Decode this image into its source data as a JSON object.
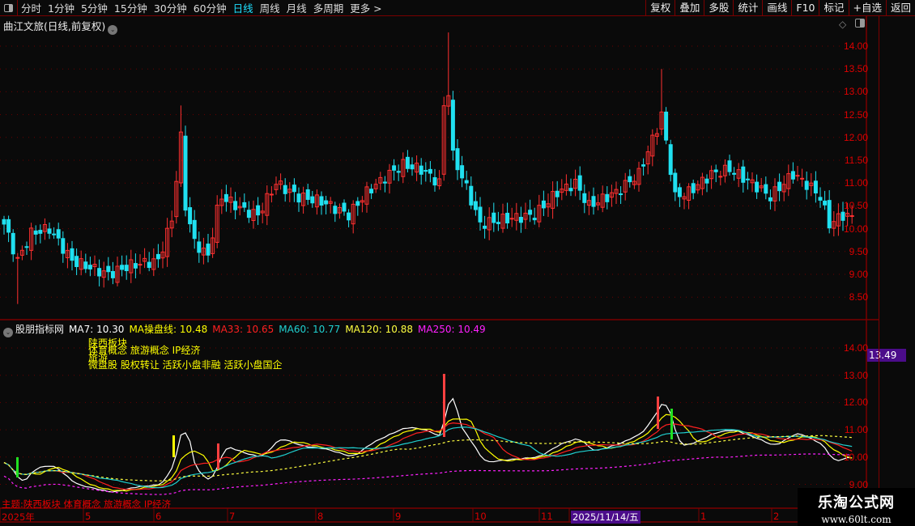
{
  "toolbar": {
    "periods": [
      "分时",
      "1分钟",
      "5分钟",
      "15分钟",
      "30分钟",
      "60分钟",
      "日线",
      "周线",
      "月线",
      "多周期",
      "更多 >"
    ],
    "active": "日线",
    "right_buttons": [
      "复权",
      "叠加",
      "多股",
      "统计",
      "画线",
      "F10",
      "标记",
      "+自选",
      "返回"
    ]
  },
  "main": {
    "title": "曲江文旅(日线,前复权)",
    "price_axis": [
      "14.00",
      "13.50",
      "13.00",
      "12.50",
      "12.00",
      "11.50",
      "11.00",
      "10.50",
      "10.00",
      "9.50",
      "9.00",
      "8.50"
    ]
  },
  "indicator": {
    "name": "股朋指标网",
    "ma": [
      {
        "label": "MA7: 10.30",
        "color": "#ffffff"
      },
      {
        "label": "MA操盘线: 10.48",
        "color": "#ffff00"
      },
      {
        "label": "MA33: 10.65",
        "color": "#ff2020"
      },
      {
        "label": "MA60: 10.77",
        "color": "#20d0d0"
      },
      {
        "label": "MA120: 10.88",
        "color": "#ffff40"
      },
      {
        "label": "MA250: 10.49",
        "color": "#ff20ff"
      }
    ],
    "concepts": [
      "陕西板块",
      "体育概念 旅游概念 IP经济",
      "旅游",
      "微盘股 股权转让 活跃小盘非融 活跃小盘国企"
    ],
    "axis": [
      "14.00",
      "13.00",
      "12.00",
      "11.00",
      "10.00",
      "9.00"
    ],
    "current_value": "13.49",
    "theme": "主题:陕西板块 体育概念 旅游概念 IP经济"
  },
  "time_axis": [
    "2025年",
    "5",
    "6",
    "7",
    "8",
    "9",
    "10",
    "11",
    "2025/11/14/五",
    "1",
    "2"
  ],
  "watermark": {
    "name": "乐淘公式网",
    "url": "www.60lt.com"
  },
  "chart_data": {
    "type": "candlestick",
    "ylim": [
      8.2,
      14.5
    ],
    "close_anchors": [
      [
        0,
        10.1
      ],
      [
        3,
        9.3
      ],
      [
        6,
        9.9
      ],
      [
        10,
        10.0
      ],
      [
        15,
        9.3
      ],
      [
        23,
        9.0
      ],
      [
        28,
        9.2
      ],
      [
        34,
        9.3
      ],
      [
        37,
        10.2
      ],
      [
        39,
        12.0
      ],
      [
        40,
        10.5
      ],
      [
        42,
        9.7
      ],
      [
        45,
        9.4
      ],
      [
        47,
        10.4
      ],
      [
        48,
        10.7
      ],
      [
        53,
        10.4
      ],
      [
        56,
        10.3
      ],
      [
        60,
        11.0
      ],
      [
        65,
        10.7
      ],
      [
        70,
        10.6
      ],
      [
        76,
        10.3
      ],
      [
        80,
        10.8
      ],
      [
        85,
        11.2
      ],
      [
        88,
        11.4
      ],
      [
        92,
        11.3
      ],
      [
        96,
        11.0
      ],
      [
        97,
        12.7
      ],
      [
        98,
        13.0
      ],
      [
        99,
        11.6
      ],
      [
        102,
        10.9
      ],
      [
        105,
        10.1
      ],
      [
        110,
        10.2
      ],
      [
        117,
        10.3
      ],
      [
        122,
        10.8
      ],
      [
        126,
        11.0
      ],
      [
        129,
        10.5
      ],
      [
        135,
        10.8
      ],
      [
        140,
        11.2
      ],
      [
        144,
        12.2
      ],
      [
        145,
        12.5
      ],
      [
        146,
        11.9
      ],
      [
        148,
        10.7
      ],
      [
        151,
        10.8
      ],
      [
        156,
        11.2
      ],
      [
        160,
        11.3
      ],
      [
        165,
        11.0
      ],
      [
        169,
        10.7
      ],
      [
        174,
        11.2
      ],
      [
        178,
        10.9
      ],
      [
        180,
        10.7
      ],
      [
        182,
        10.1
      ],
      [
        185,
        10.3
      ],
      [
        187,
        10.25
      ]
    ],
    "spikes": [
      [
        39,
        12.7
      ],
      [
        98,
        14.3
      ],
      [
        145,
        13.5
      ],
      [
        3,
        8.35
      ]
    ]
  },
  "colors": {
    "up": "#ff3030",
    "down": "#20e0f0",
    "grid": "#7a0000"
  }
}
